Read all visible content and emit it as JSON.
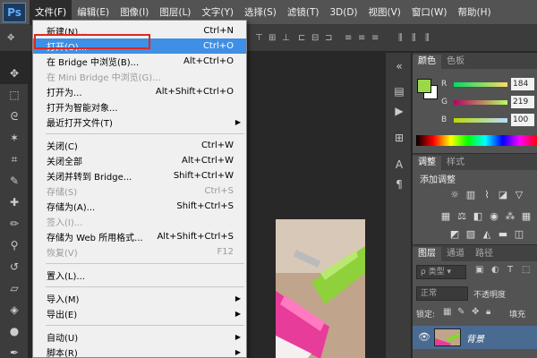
{
  "app": {
    "logo": "Ps"
  },
  "menubar": {
    "items": [
      {
        "label": "文件(F)",
        "active": true
      },
      {
        "label": "编辑(E)"
      },
      {
        "label": "图像(I)"
      },
      {
        "label": "图层(L)"
      },
      {
        "label": "文字(Y)"
      },
      {
        "label": "选择(S)"
      },
      {
        "label": "滤镜(T)"
      },
      {
        "label": "3D(D)"
      },
      {
        "label": "视图(V)"
      },
      {
        "label": "窗口(W)"
      },
      {
        "label": "帮助(H)"
      }
    ]
  },
  "file_menu": {
    "items": [
      {
        "label": "新建(N)...",
        "shortcut": "Ctrl+N"
      },
      {
        "label": "打开(O)...",
        "shortcut": "Ctrl+O",
        "highlighted": true
      },
      {
        "label": "在 Bridge 中浏览(B)...",
        "shortcut": "Alt+Ctrl+O"
      },
      {
        "label": "在 Mini Bridge 中浏览(G)...",
        "disabled": true
      },
      {
        "label": "打开为...",
        "shortcut": "Alt+Shift+Ctrl+O"
      },
      {
        "label": "打开为智能对象..."
      },
      {
        "label": "最近打开文件(T)",
        "submenu": true
      },
      {
        "label": "关闭(C)",
        "shortcut": "Ctrl+W"
      },
      {
        "label": "关闭全部",
        "shortcut": "Alt+Ctrl+W"
      },
      {
        "label": "关闭并转到 Bridge...",
        "shortcut": "Shift+Ctrl+W"
      },
      {
        "label": "存储(S)",
        "shortcut": "Ctrl+S",
        "disabled": true
      },
      {
        "label": "存储为(A)...",
        "shortcut": "Shift+Ctrl+S"
      },
      {
        "label": "签入(I)...",
        "disabled": true
      },
      {
        "label": "存储为 Web 所用格式...",
        "shortcut": "Alt+Shift+Ctrl+S"
      },
      {
        "label": "恢复(V)",
        "shortcut": "F12",
        "disabled": true
      },
      {
        "label": "置入(L)..."
      },
      {
        "label": "导入(M)",
        "submenu": true
      },
      {
        "label": "导出(E)",
        "submenu": true
      },
      {
        "label": "自动(U)",
        "submenu": true
      },
      {
        "label": "脚本(R)",
        "submenu": true
      }
    ]
  },
  "color_panel": {
    "tabs": [
      "颜色",
      "色板"
    ],
    "foreground": "#9ad84a",
    "background_swatch": "#ffffff",
    "channels": [
      {
        "label": "R",
        "value": "184"
      },
      {
        "label": "G",
        "value": "219"
      },
      {
        "label": "B",
        "value": "100"
      }
    ]
  },
  "adjust_panel": {
    "tabs": [
      "调整",
      "样式"
    ],
    "title": "添加调整"
  },
  "layers_panel": {
    "tabs": [
      "图层",
      "通道",
      "路径"
    ],
    "filter_kind": "类型",
    "blend_mode": "正常",
    "opacity_label": "不透明度",
    "lock_label": "锁定:",
    "fill_label": "填充",
    "layer_name": "背景"
  },
  "colors": {
    "highlight": "#3f8fe6",
    "annotation_box": "#e0281e"
  }
}
